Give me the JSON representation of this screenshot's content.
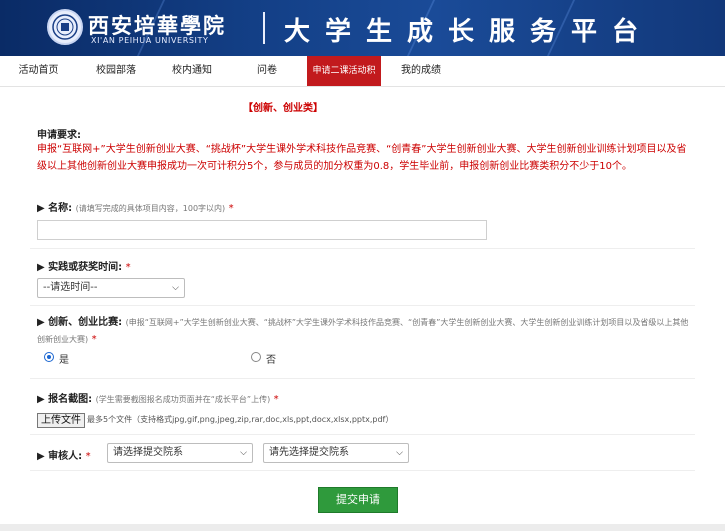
{
  "header": {
    "school_name_cn": "西安培華學院",
    "school_name_en": "XI'AN PEIHUA UNIVERSITY",
    "platform_title": "大学生成长服务平台"
  },
  "nav": {
    "items": [
      {
        "label": "活动首页",
        "active": false
      },
      {
        "label": "校园部落",
        "active": false
      },
      {
        "label": "校内通知",
        "active": false
      },
      {
        "label": "问卷",
        "active": false
      },
      {
        "label": "申请二课活动积",
        "active": true
      },
      {
        "label": "我的成绩",
        "active": false
      }
    ]
  },
  "form": {
    "section_title": "【创新、创业类】",
    "requirements_label": "申请要求:",
    "requirements_text": "申报“互联网+”大学生创新创业大赛、“挑战杯”大学生课外学术科技作品竞赛、“创青春”大学生创新创业大赛、大学生创新创业训练计划项目以及省级以上其他创新创业大赛申报成功一次可计积分5个，参与成员的加分权重为0.8，学生毕业前，申报创新创业比赛类积分不少于10个。",
    "name_label": "▶ 名称:",
    "name_hint": "(请填写完成的具体项目内容，100字以内)",
    "name_value": "",
    "time_label": "▶ 实践或获奖时间:",
    "time_select": "--请选时间--",
    "competition_label": "▶ 创新、创业比赛:",
    "competition_hint": "(申报“互联网+”大学生创新创业大赛、“挑战杯”大学生课外学术科技作品竞赛、“创青春”大学生创新创业大赛、大学生创新创业训练计划项目以及省级以上其他创新创业大赛)",
    "yes_label": "是",
    "no_label": "否",
    "yes_checked": true,
    "screenshot_label": "▶ 报名截图:",
    "screenshot_hint": "(学生需要截图报名成功页面并在“成长平台”上传)",
    "upload_button": "上传文件",
    "upload_note": "最多5个文件（支持格式jpg,gif,png,jpeg,zip,rar,doc,xls,ppt,docx,xlsx,pptx,pdf）",
    "reviewer_label": "▶ 审核人:",
    "college_select": "请选择提交院系",
    "reviewer_select": "请先选择提交院系",
    "required_mark": "*",
    "submit_label": "提交申请"
  },
  "colors": {
    "accent_red": "#cc0000",
    "nav_active": "#c21a1d",
    "submit_green": "#2f9a3c",
    "banner_blue": "#133f86"
  }
}
